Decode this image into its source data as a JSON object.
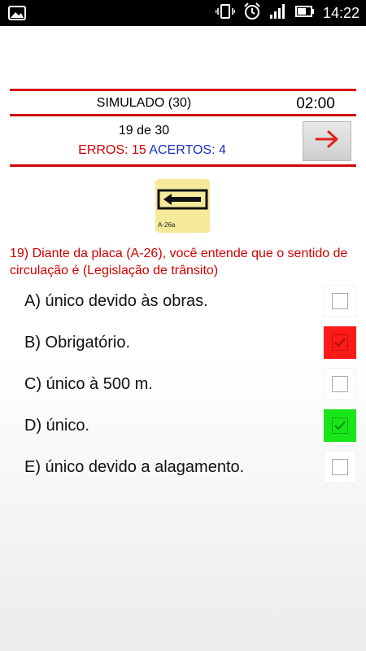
{
  "status_bar": {
    "time": "14:22",
    "icons": [
      "image-icon",
      "vibrate-icon",
      "alarm-icon",
      "signal-icon",
      "battery-icon"
    ]
  },
  "header": {
    "title": "SIMULADO (30)",
    "timer": "02:00"
  },
  "progress": {
    "counter": "19 de 30",
    "errors_label": "ERROS: 15",
    "correct_label": "ACERTOS: 4"
  },
  "sign": {
    "code": "A-26a",
    "icon": "left-arrow-sign"
  },
  "question": "19) Diante da placa (A-26), você entende que o sentido de circulação é (Legislação de trânsito)",
  "options": [
    {
      "label": "A) único devido às obras.",
      "state": "unchecked"
    },
    {
      "label": "B) Obrigatório.",
      "state": "wrong"
    },
    {
      "label": "C) único à 500 m.",
      "state": "unchecked"
    },
    {
      "label": "D) único.",
      "state": "correct"
    },
    {
      "label": "E) único devido a alagamento.",
      "state": "unchecked"
    }
  ],
  "colors": {
    "accent_red": "#d10000",
    "correct_blue": "#1a2fc0",
    "wrong_fill": "#ff1a1a",
    "correct_fill": "#19e619",
    "sign_yellow": "#f6e99a"
  }
}
